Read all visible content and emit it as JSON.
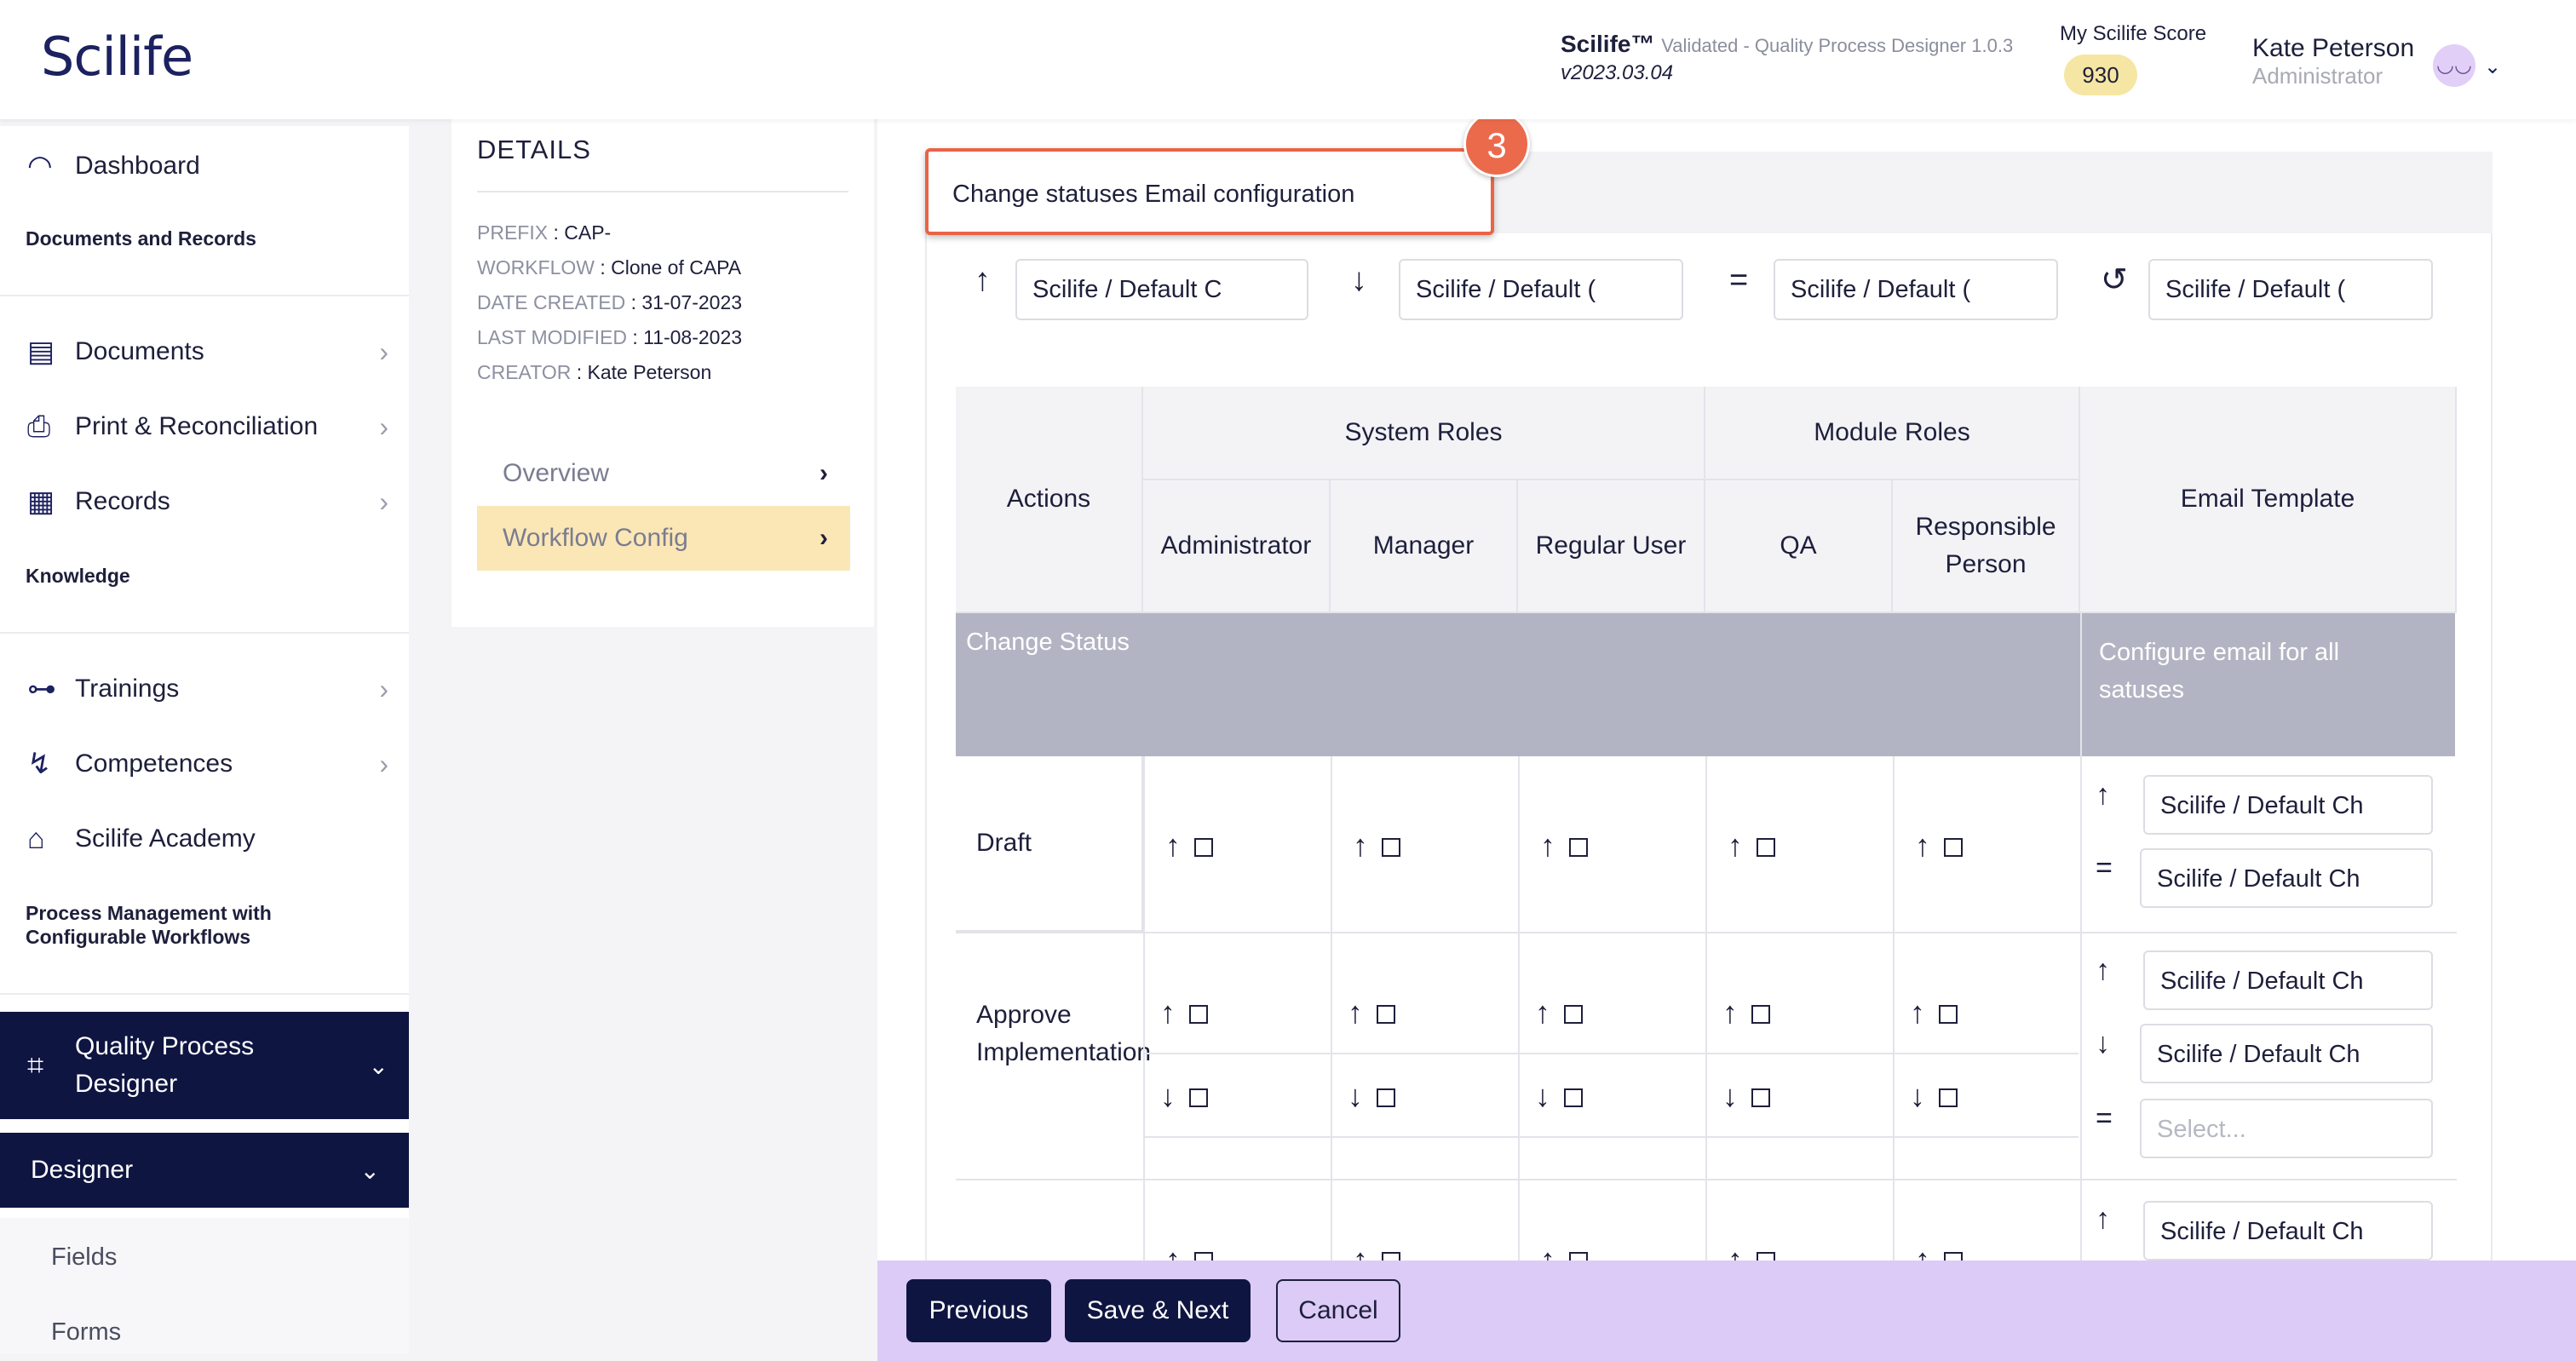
{
  "header": {
    "logo": "Scilife",
    "product": "Scilife™",
    "product_tag": "Validated - Quality Process Designer 1.0.3",
    "version": "v2023.03.04",
    "score_label": "My Scilife Score",
    "score_value": "930",
    "user_name": "Kate Peterson",
    "user_role": "Administrator"
  },
  "sidebar": {
    "dashboard": "Dashboard",
    "sec_docs": "Documents and Records",
    "documents": "Documents",
    "print": "Print & Reconciliation",
    "records": "Records",
    "sec_knowledge": "Knowledge",
    "trainings": "Trainings",
    "competences": "Competences",
    "academy": "Scilife Academy",
    "sec_process": "Process Management with Configurable Workflows",
    "qpd": "Quality Process Designer",
    "designer": "Designer",
    "fields": "Fields",
    "forms": "Forms"
  },
  "details": {
    "title": "DETAILS",
    "prefix_k": "PREFIX",
    "prefix_v": ": CAP-",
    "workflow_k": "WORKFLOW",
    "workflow_v": ": Clone of CAPA",
    "created_k": "DATE CREATED",
    "created_v": ": 31-07-2023",
    "modified_k": "LAST MODIFIED",
    "modified_v": ": 11-08-2023",
    "creator_k": "CREATOR",
    "creator_v": ": Kate Peterson",
    "tab_overview": "Overview",
    "tab_workflow": "Workflow Config"
  },
  "config": {
    "title": "Change statuses Email configuration",
    "step": "3",
    "global_selects": [
      "Scilife / Default C",
      "Scilife / Default (",
      "Scilife / Default (",
      "Scilife / Default ("
    ]
  },
  "table": {
    "h_actions": "Actions",
    "h_system": "System Roles",
    "h_module": "Module Roles",
    "h_email": "Email Template",
    "roles": [
      "Administrator",
      "Manager",
      "Regular User",
      "QA",
      "Responsible Person"
    ],
    "change_status": "Change Status",
    "configure_all": "Configure email for all satuses",
    "rows": [
      {
        "action": "Draft",
        "templates": [
          "Scilife / Default Ch",
          "Scilife / Default Ch"
        ]
      },
      {
        "action": "Approve Implementation",
        "templates": [
          "Scilife / Default Ch",
          "Scilife / Default Ch",
          "Select..."
        ]
      },
      {
        "action": "",
        "templates": [
          "Scilife / Default Ch"
        ]
      }
    ]
  },
  "footer": {
    "previous": "Previous",
    "save_next": "Save & Next",
    "cancel": "Cancel"
  }
}
